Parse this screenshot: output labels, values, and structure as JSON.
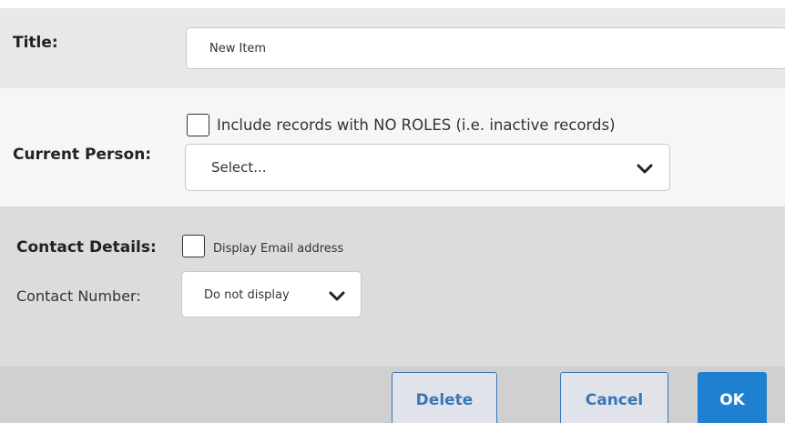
{
  "form": {
    "title": {
      "label": "Title:",
      "value": "New Item"
    },
    "current_person": {
      "label": "Current Person:",
      "include_inactive_label": "Include records with NO ROLES (i.e. inactive records)",
      "include_inactive_checked": false,
      "select_value": "Select..."
    },
    "contact_details": {
      "label": "Contact Details:",
      "display_email_label": "Display Email address",
      "display_email_checked": false,
      "contact_number_label": "Contact Number:",
      "contact_number_value": "Do not display"
    }
  },
  "footer": {
    "delete_label": "Delete",
    "cancel_label": "Cancel",
    "ok_label": "OK"
  },
  "colors": {
    "primary": "#1f7fd0",
    "secondary_text": "#3a75b8",
    "title_row_bg": "#e8e8e8",
    "person_row_bg": "#f6f6f6",
    "contact_row_bg": "#dcdcdc",
    "footer_bg": "#d0d0d0"
  },
  "icons": {
    "dropdown": "chevron-down-icon"
  }
}
